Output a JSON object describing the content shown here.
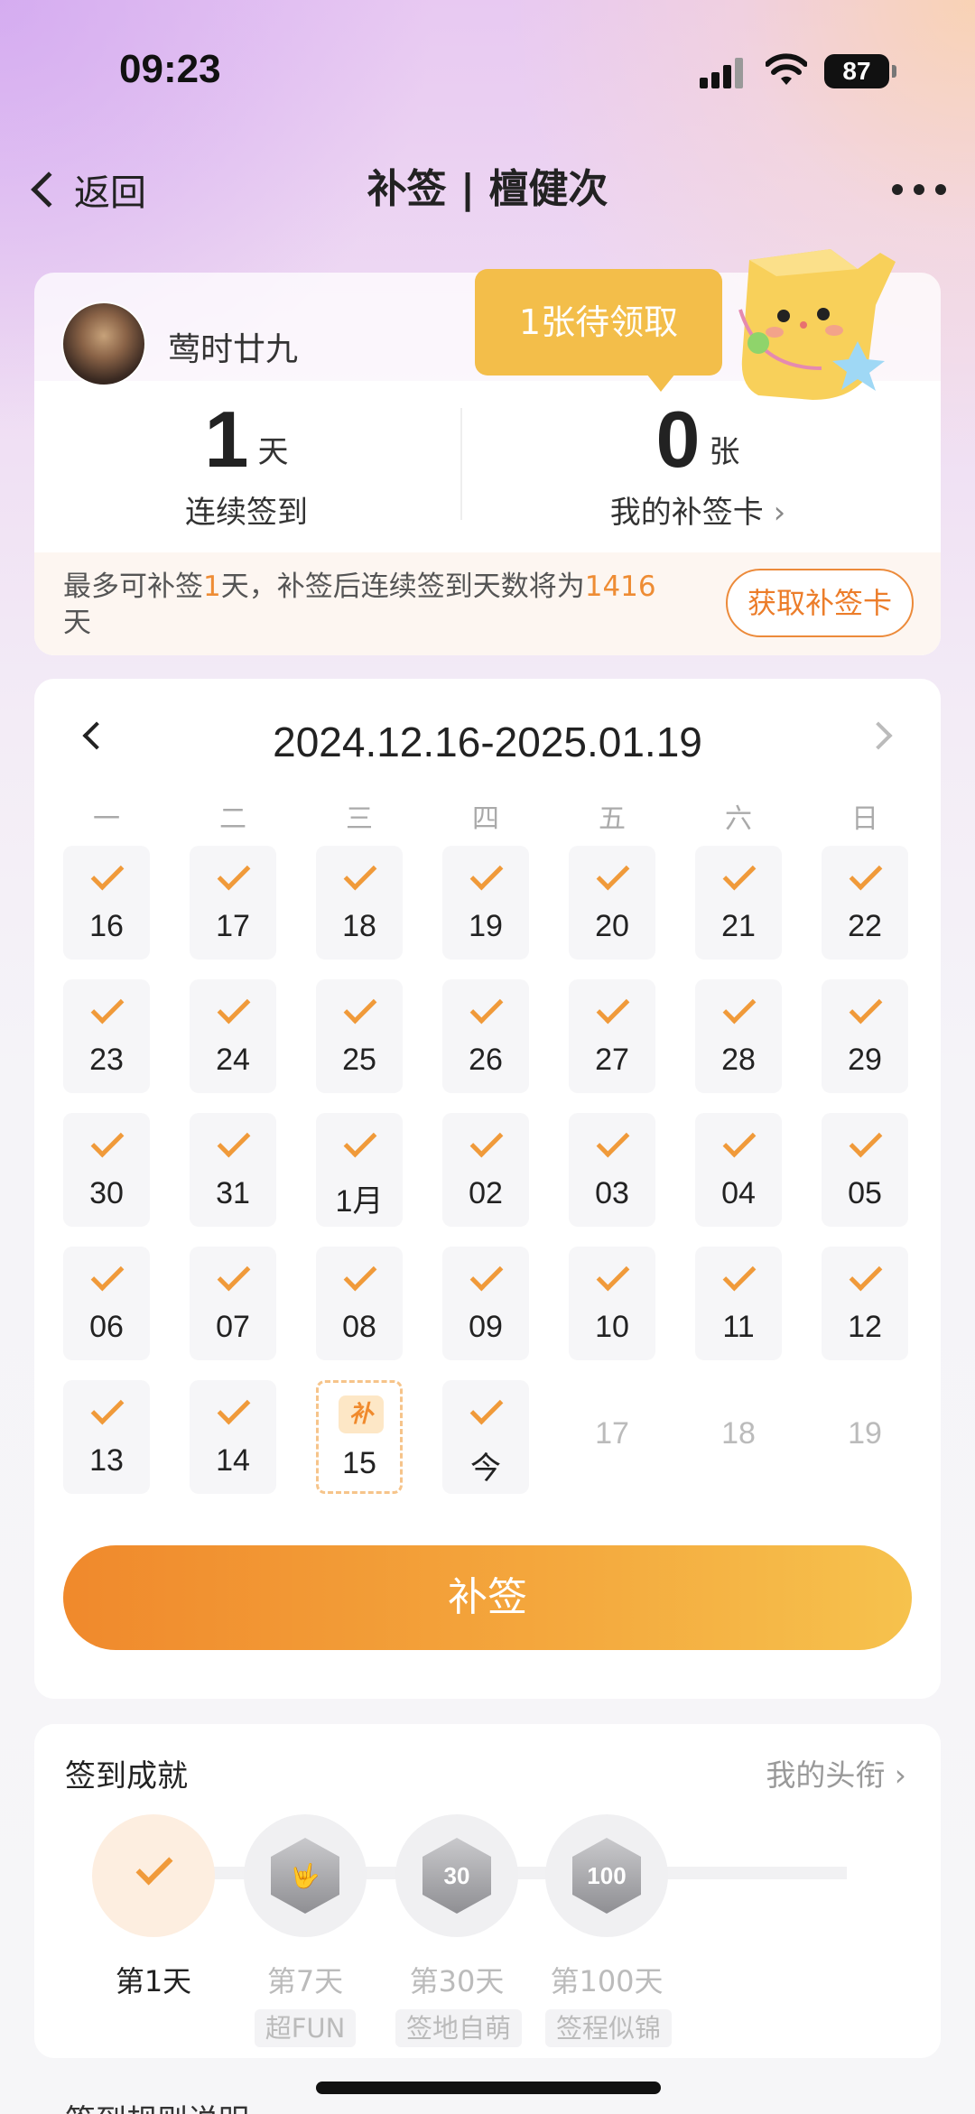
{
  "status_bar": {
    "time": "09:23",
    "battery": "87"
  },
  "nav": {
    "back_label": "返回",
    "title": "补签 | 檀健次"
  },
  "profile": {
    "username": "莺时廿九"
  },
  "bubble": {
    "text": "1张待领取"
  },
  "stats": {
    "streak": {
      "value": "1",
      "unit": "天",
      "label": "连续签到"
    },
    "cards": {
      "value": "0",
      "unit": "张",
      "label": "我的补签卡",
      "arrow": "›"
    }
  },
  "tip": {
    "part1": "最多可补签",
    "days": "1",
    "part2": "天，补签后连续签到天数将为",
    "total": "1416",
    "part3": "天",
    "button": "获取补签卡"
  },
  "calendar": {
    "range": "2024.12.16-2025.01.19",
    "weekdays": [
      "一",
      "二",
      "三",
      "四",
      "五",
      "六",
      "日"
    ],
    "days": [
      {
        "label": "16",
        "state": "checked"
      },
      {
        "label": "17",
        "state": "checked"
      },
      {
        "label": "18",
        "state": "checked"
      },
      {
        "label": "19",
        "state": "checked"
      },
      {
        "label": "20",
        "state": "checked"
      },
      {
        "label": "21",
        "state": "checked"
      },
      {
        "label": "22",
        "state": "checked"
      },
      {
        "label": "23",
        "state": "checked"
      },
      {
        "label": "24",
        "state": "checked"
      },
      {
        "label": "25",
        "state": "checked"
      },
      {
        "label": "26",
        "state": "checked"
      },
      {
        "label": "27",
        "state": "checked"
      },
      {
        "label": "28",
        "state": "checked"
      },
      {
        "label": "29",
        "state": "checked"
      },
      {
        "label": "30",
        "state": "checked"
      },
      {
        "label": "31",
        "state": "checked"
      },
      {
        "label": "1月",
        "state": "checked"
      },
      {
        "label": "02",
        "state": "checked"
      },
      {
        "label": "03",
        "state": "checked"
      },
      {
        "label": "04",
        "state": "checked"
      },
      {
        "label": "05",
        "state": "checked"
      },
      {
        "label": "06",
        "state": "checked"
      },
      {
        "label": "07",
        "state": "checked"
      },
      {
        "label": "08",
        "state": "checked"
      },
      {
        "label": "09",
        "state": "checked"
      },
      {
        "label": "10",
        "state": "checked"
      },
      {
        "label": "11",
        "state": "checked"
      },
      {
        "label": "12",
        "state": "checked"
      },
      {
        "label": "13",
        "state": "checked"
      },
      {
        "label": "14",
        "state": "checked"
      },
      {
        "label": "15",
        "state": "makeup",
        "badge": "补"
      },
      {
        "label": "今",
        "state": "checked"
      },
      {
        "label": "17",
        "state": "future"
      },
      {
        "label": "18",
        "state": "future"
      },
      {
        "label": "19",
        "state": "future"
      }
    ],
    "button": "补签"
  },
  "achievements": {
    "title": "签到成就",
    "link": "我的头衔 ›",
    "badges": [
      {
        "label": "第1天",
        "tag": "",
        "icon": "check-icon",
        "done": true
      },
      {
        "label": "第7天",
        "tag": "超FUN",
        "icon": "hand-badge-icon",
        "done": false,
        "glyph": "🤟"
      },
      {
        "label": "第30天",
        "tag": "签地自萌",
        "icon": "30-days-badge-icon",
        "done": false,
        "glyph": "30"
      },
      {
        "label": "第100天",
        "tag": "签程似锦",
        "icon": "100-days-badge-icon",
        "done": false,
        "glyph": "100"
      }
    ]
  },
  "peek": {
    "text": "签到规则说明"
  },
  "colors": {
    "accent": "#f09a3a",
    "bubble": "#f3be4a",
    "button_start": "#f0892c",
    "button_end": "#f6c24d"
  }
}
